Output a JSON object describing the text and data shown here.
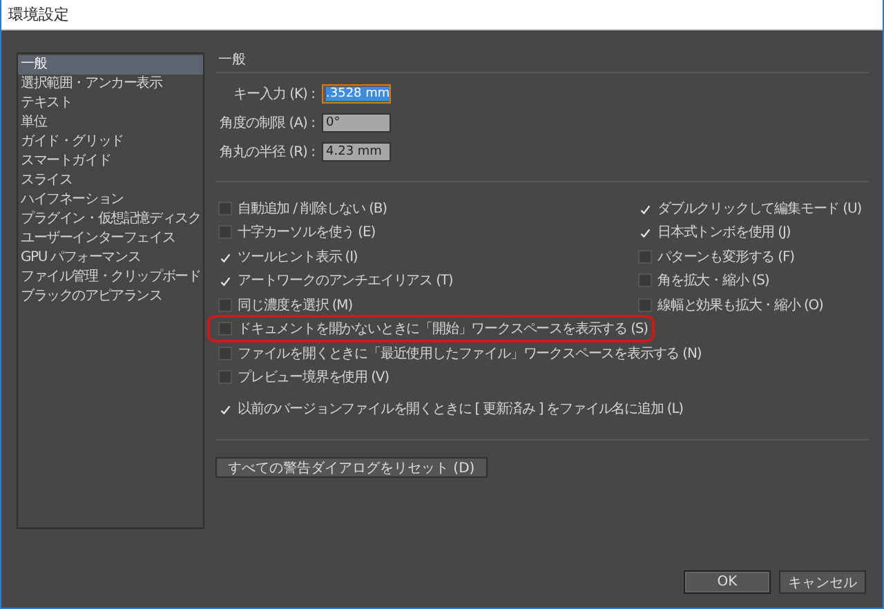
{
  "window": {
    "title": "環境設定"
  },
  "sidebar": {
    "items": [
      {
        "label": "一般",
        "selected": true
      },
      {
        "label": "選択範囲・アンカー表示",
        "selected": false
      },
      {
        "label": "テキスト",
        "selected": false
      },
      {
        "label": "単位",
        "selected": false
      },
      {
        "label": "ガイド・グリッド",
        "selected": false
      },
      {
        "label": "スマートガイド",
        "selected": false
      },
      {
        "label": "スライス",
        "selected": false
      },
      {
        "label": "ハイフネーション",
        "selected": false
      },
      {
        "label": "プラグイン・仮想記憶ディスク",
        "selected": false
      },
      {
        "label": "ユーザーインターフェイス",
        "selected": false
      },
      {
        "label": "GPU パフォーマンス",
        "selected": false
      },
      {
        "label": "ファイル管理・クリップボード",
        "selected": false
      },
      {
        "label": "ブラックのアピアランス",
        "selected": false
      }
    ]
  },
  "section_title": "一般",
  "fields": [
    {
      "label": "キー入力 (K) :",
      "value": ".3528 mm",
      "focused": true
    },
    {
      "label": "角度の制限 (A) :",
      "value": "0°",
      "focused": false
    },
    {
      "label": "角丸の半径 (R) :",
      "value": "4.23 mm",
      "focused": false
    }
  ],
  "options_left": [
    {
      "label": "自動追加 / 削除しない (B)",
      "checked": false,
      "highlighted": false
    },
    {
      "label": "十字カーソルを使う (E)",
      "checked": false,
      "highlighted": false
    },
    {
      "label": "ツールヒント表示 (I)",
      "checked": true,
      "highlighted": false
    },
    {
      "label": "アートワークのアンチエイリアス (T)",
      "checked": true,
      "highlighted": false
    },
    {
      "label": "同じ濃度を選択 (M)",
      "checked": false,
      "highlighted": false
    },
    {
      "label": "ドキュメントを開かないときに「開始」ワークスペースを表示する (S)",
      "checked": false,
      "highlighted": true
    },
    {
      "label": "ファイルを開くときに「最近使用したファイル」ワークスペースを表示する (N)",
      "checked": false,
      "highlighted": false
    },
    {
      "label": "プレビュー境界を使用 (V)",
      "checked": false,
      "highlighted": false
    },
    {
      "label": "以前のバージョンファイルを開くときに [ 更新済み ] をファイル名に追加 (L)",
      "checked": true,
      "highlighted": false
    }
  ],
  "options_right": [
    {
      "label": "ダブルクリックして編集モード (U)",
      "checked": true
    },
    {
      "label": "日本式トンボを使用 (J)",
      "checked": true
    },
    {
      "label": "パターンも変形する (F)",
      "checked": false
    },
    {
      "label": "角を拡大・縮小 (S)",
      "checked": false
    },
    {
      "label": "線幅と効果も拡大・縮小 (O)",
      "checked": false
    }
  ],
  "reset_button": "すべての警告ダイアログをリセット (D)",
  "buttons": [
    "OK",
    "キャンセル"
  ]
}
